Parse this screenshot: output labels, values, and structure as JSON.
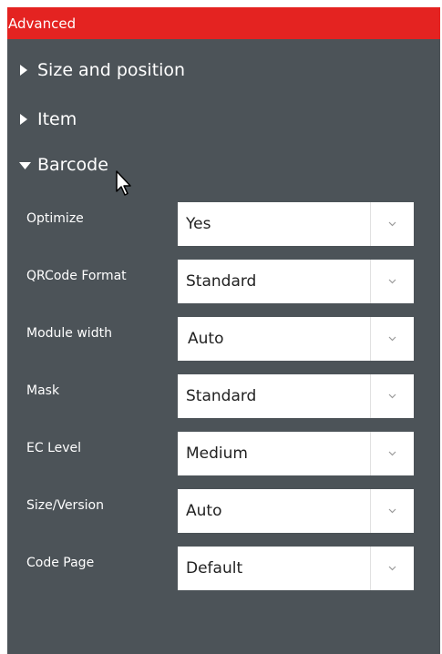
{
  "panel": {
    "title": "Advanced",
    "header_color": "#e42321",
    "background_color": "#4c5358"
  },
  "sections": [
    {
      "label": "Size and position",
      "expanded": false,
      "icon": "caret-right-icon"
    },
    {
      "label": "Item",
      "expanded": false,
      "icon": "caret-right-icon"
    },
    {
      "label": "Barcode",
      "expanded": true,
      "icon": "caret-down-icon"
    }
  ],
  "barcode": {
    "fields": [
      {
        "label": "Optimize",
        "value": "Yes",
        "icon": "chevron-down-icon"
      },
      {
        "label": "QRCode Format",
        "value": "Standard",
        "icon": "chevron-down-icon"
      },
      {
        "label": "Module width",
        "value": "Auto",
        "icon": "chevron-down-icon"
      },
      {
        "label": "Mask",
        "value": "Standard",
        "icon": "chevron-down-icon"
      },
      {
        "label": "EC Level",
        "value": "Medium",
        "icon": "chevron-down-icon"
      },
      {
        "label": "Size/Version",
        "value": "Auto",
        "icon": "chevron-down-icon"
      },
      {
        "label": "Code Page",
        "value": "Default",
        "icon": "chevron-down-icon"
      }
    ]
  },
  "cursor": {
    "icon": "mouse-pointer-icon"
  }
}
